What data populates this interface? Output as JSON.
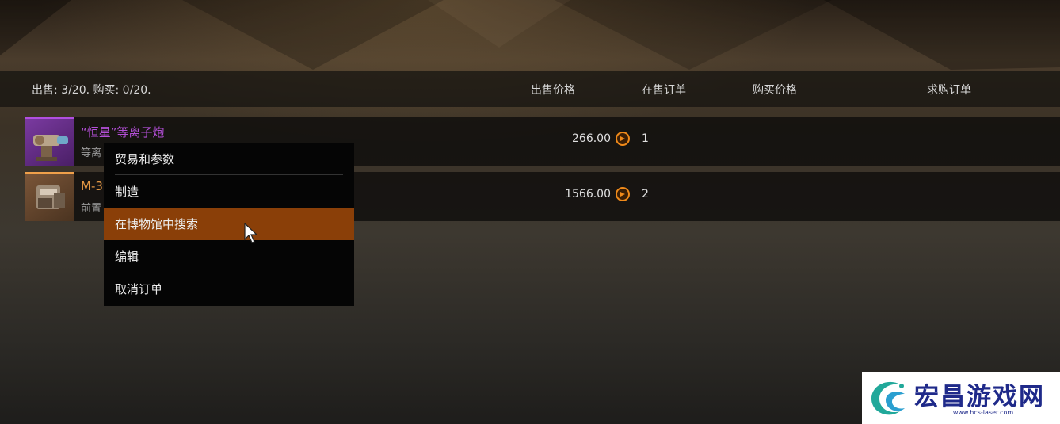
{
  "header": {
    "stats": "出售: 3/20. 购买: 0/20.",
    "columns": {
      "sell_price": "出售价格",
      "sell_orders": "在售订单",
      "buy_price": "购买价格",
      "buy_orders": "求购订单"
    }
  },
  "rows": [
    {
      "name": "“恒星”等离子炮",
      "subtitle": "等离",
      "price": "266.00",
      "orders": "1",
      "rarity_color": "#b14fe0",
      "name_color": "#b44fd8",
      "icon": "plasma-cannon-icon"
    },
    {
      "name": "M-3",
      "subtitle": "前置",
      "price": "1566.00",
      "orders": "2",
      "rarity_color": "#f0a04a",
      "name_color": "#e89a45",
      "icon": "device-icon"
    }
  ],
  "context_menu": {
    "items": [
      {
        "label": "贸易和参数"
      },
      {
        "label": "制造"
      },
      {
        "label": "在博物馆中搜索"
      },
      {
        "label": "编辑"
      },
      {
        "label": "取消订单"
      }
    ],
    "active_index": 2,
    "active_color": "#8a3f08"
  },
  "currency_icon": "coin-icon",
  "watermark": {
    "title": "宏昌游戏网",
    "url": "www.hcs-laser.com",
    "color": "#1f2a8a"
  }
}
